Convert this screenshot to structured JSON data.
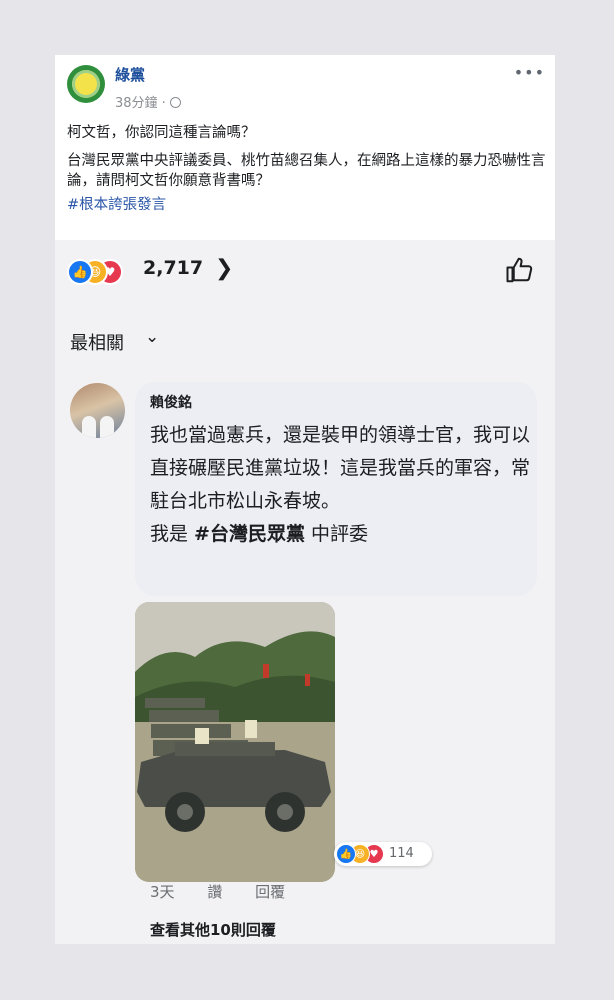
{
  "post": {
    "page_name": "綠黨",
    "time": "38分鐘 ·",
    "more_icon": "more-horizontal-icon",
    "line1": "柯文哲，你認同這種言論嗎？",
    "line2": "台灣民眾黨中央評議委員、桃竹苗總召集人，在網路上這樣的暴力恐嚇性言論，請問柯文哲你願意背書嗎？",
    "hashtag": "#根本誇張發言"
  },
  "reactions": {
    "count": "2,717",
    "icons": [
      "like-icon",
      "haha-icon",
      "love-icon"
    ]
  },
  "sort": {
    "label": "最相關"
  },
  "comment": {
    "author": "賴俊銘",
    "text_main": "我也當過憲兵，還是裝甲的領導士官，我可以直接碾壓民進黨垃圾！這是我當兵的軍容，常駐台北市松山永春坡。",
    "text_pre": "我是 ",
    "text_tag": "#台灣民眾黨",
    "text_post": " 中評委",
    "reaction_count": "114",
    "time": "3天",
    "like_label": "讚",
    "reply_label": "回覆"
  },
  "view_more": "查看其他10則回覆",
  "colors": {
    "link_blue": "#2b56a8",
    "like_blue": "#1877f2",
    "haha_yellow": "#f7b125",
    "love_red": "#e63950"
  }
}
